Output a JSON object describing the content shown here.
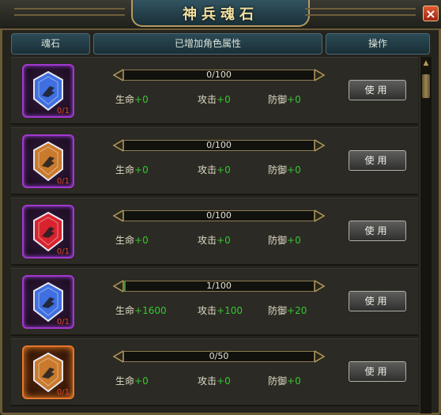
{
  "window": {
    "title": "神兵魂石",
    "close_symbol": "×"
  },
  "header": {
    "col_stone": "魂石",
    "col_attrs": "已增加角色属性",
    "col_action": "操作"
  },
  "rows": [
    {
      "gem_color": "blue",
      "frame": "purple",
      "count": "0/1",
      "progress": "0/100",
      "progress_fraction": 0,
      "hp_label": "生命",
      "hp_value": "+0",
      "atk_label": "攻击",
      "atk_value": "+0",
      "def_label": "防御",
      "def_value": "+0",
      "button": "使用"
    },
    {
      "gem_color": "amber",
      "frame": "purple",
      "count": "0/1",
      "progress": "0/100",
      "progress_fraction": 0,
      "hp_label": "生命",
      "hp_value": "+0",
      "atk_label": "攻击",
      "atk_value": "+0",
      "def_label": "防御",
      "def_value": "+0",
      "button": "使用"
    },
    {
      "gem_color": "red",
      "frame": "purple",
      "count": "0/1",
      "progress": "0/100",
      "progress_fraction": 0,
      "hp_label": "生命",
      "hp_value": "+0",
      "atk_label": "攻击",
      "atk_value": "+0",
      "def_label": "防御",
      "def_value": "+0",
      "button": "使用"
    },
    {
      "gem_color": "blue",
      "frame": "purple",
      "count": "0/1",
      "progress": "1/100",
      "progress_fraction": 0.01,
      "hp_label": "生命",
      "hp_value": "+1600",
      "atk_label": "攻击",
      "atk_value": "+100",
      "def_label": "防御",
      "def_value": "+20",
      "button": "使用"
    },
    {
      "gem_color": "amber",
      "frame": "orange",
      "count": "0/1",
      "progress": "0/50",
      "progress_fraction": 0,
      "hp_label": "生命",
      "hp_value": "+0",
      "atk_label": "攻击",
      "atk_value": "+0",
      "def_label": "防御",
      "def_value": "+0",
      "button": "使用"
    }
  ],
  "colors": {
    "stat_value": "#34c830",
    "count_text": "#e04a2a",
    "title_text": "#f1dfa0",
    "gem_blue": "#3f6fe0",
    "gem_amber": "#c97a2c",
    "gem_red": "#d8232e"
  },
  "icons": {
    "gem": "gem-shield-icon",
    "close": "close-icon",
    "scroll_up": "scroll-up-arrow-icon"
  }
}
